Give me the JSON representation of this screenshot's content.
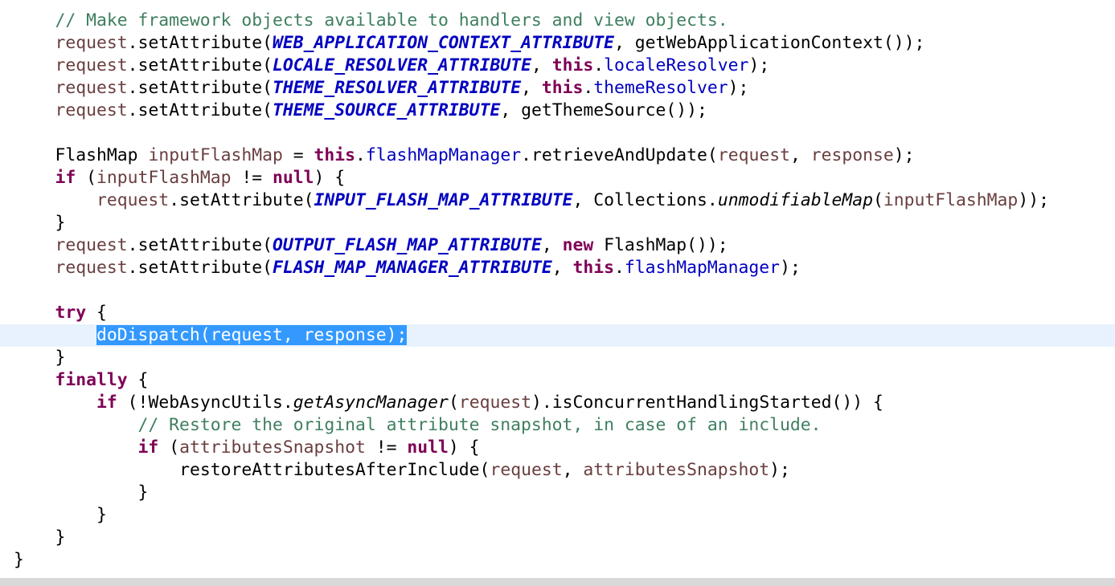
{
  "editor": {
    "lines": [
      "    // Make framework objects available to handlers and view objects.",
      "    request.setAttribute(WEB_APPLICATION_CONTEXT_ATTRIBUTE, getWebApplicationContext());",
      "    request.setAttribute(LOCALE_RESOLVER_ATTRIBUTE, this.localeResolver);",
      "    request.setAttribute(THEME_RESOLVER_ATTRIBUTE, this.themeResolver);",
      "    request.setAttribute(THEME_SOURCE_ATTRIBUTE, getThemeSource());",
      "",
      "    FlashMap inputFlashMap = this.flashMapManager.retrieveAndUpdate(request, response);",
      "    if (inputFlashMap != null) {",
      "        request.setAttribute(INPUT_FLASH_MAP_ATTRIBUTE, Collections.unmodifiableMap(inputFlashMap));",
      "    }",
      "    request.setAttribute(OUTPUT_FLASH_MAP_ATTRIBUTE, new FlashMap());",
      "    request.setAttribute(FLASH_MAP_MANAGER_ATTRIBUTE, this.flashMapManager);",
      "",
      "    try {",
      "        doDispatch(request, response);",
      "    }",
      "    finally {",
      "        if (!WebAsyncUtils.getAsyncManager(request).isConcurrentHandlingStarted()) {",
      "            // Restore the original attribute snapshot, in case of an include.",
      "            if (attributesSnapshot != null) {",
      "                restoreAttributesAfterInclude(request, attributesSnapshot);",
      "            }",
      "        }",
      "    }",
      "}"
    ],
    "current_line_index": 14,
    "selected_text": "doDispatch(request, response);"
  },
  "colors": {
    "comment": "#3f7f5f",
    "keyword": "#7f0055",
    "static_field": "#0000c0",
    "field": "#0000c0",
    "local_variable": "#6a3e3e",
    "selection": "#3399ff",
    "current_line": "#e8f2fe"
  }
}
